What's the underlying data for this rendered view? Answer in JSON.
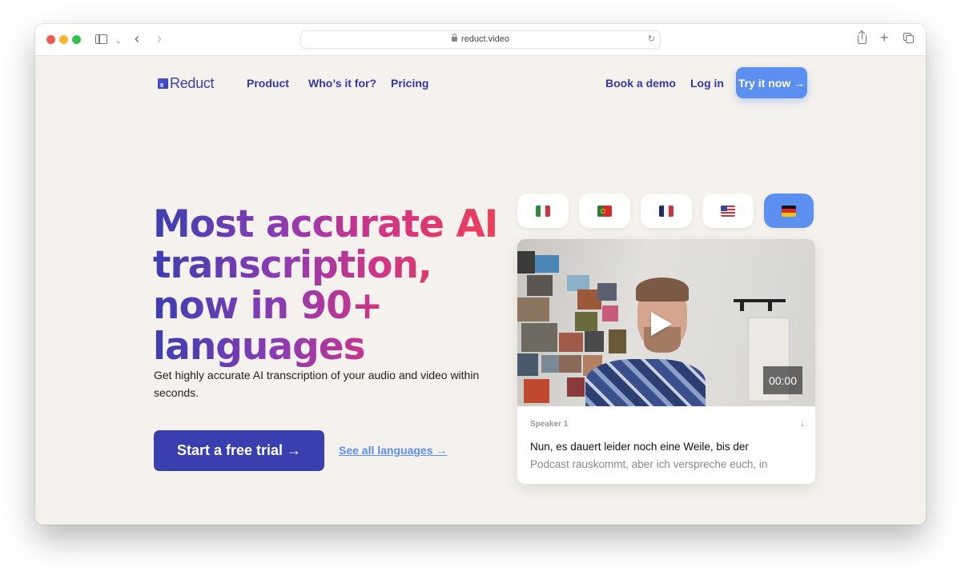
{
  "browser": {
    "url": "reduct.video",
    "icons": [
      "sidebar-icon",
      "chevron-down-icon",
      "back-icon",
      "forward-icon",
      "lock-icon",
      "reload-icon",
      "share-icon",
      "new-tab-icon",
      "tabs-overview-icon"
    ]
  },
  "nav": {
    "logo": "Reduct",
    "links": [
      "Product",
      "Who’s it for?",
      "Pricing"
    ],
    "book_demo": "Book a demo",
    "login": "Log in",
    "try_now": "Try it now →"
  },
  "hero": {
    "headline": "Most accurate AI transcription, now in 90+ languages",
    "subtext": "Get highly accurate AI transcription of your audio and video within seconds.",
    "cta": "Start a free trial →",
    "see_all": "See all languages →"
  },
  "languages": [
    {
      "name": "Italian",
      "flag": "italy-flag",
      "active": false
    },
    {
      "name": "Portuguese",
      "flag": "portugal-flag",
      "active": false
    },
    {
      "name": "French",
      "flag": "france-flag",
      "active": false
    },
    {
      "name": "English",
      "flag": "usa-flag",
      "active": false
    },
    {
      "name": "German",
      "flag": "germany-flag",
      "active": true
    }
  ],
  "video": {
    "timestamp": "00:00",
    "speaker": "Speaker 1",
    "transcript_line1": "Nun, es dauert leider noch eine Weile, bis der",
    "transcript_line2": "Podcast rauskommt, aber ich verspreche euch, in"
  },
  "colors": {
    "accent_blue": "#5b8ff0",
    "brand_indigo": "#3a3fb0",
    "background": "#f5f1ed"
  }
}
